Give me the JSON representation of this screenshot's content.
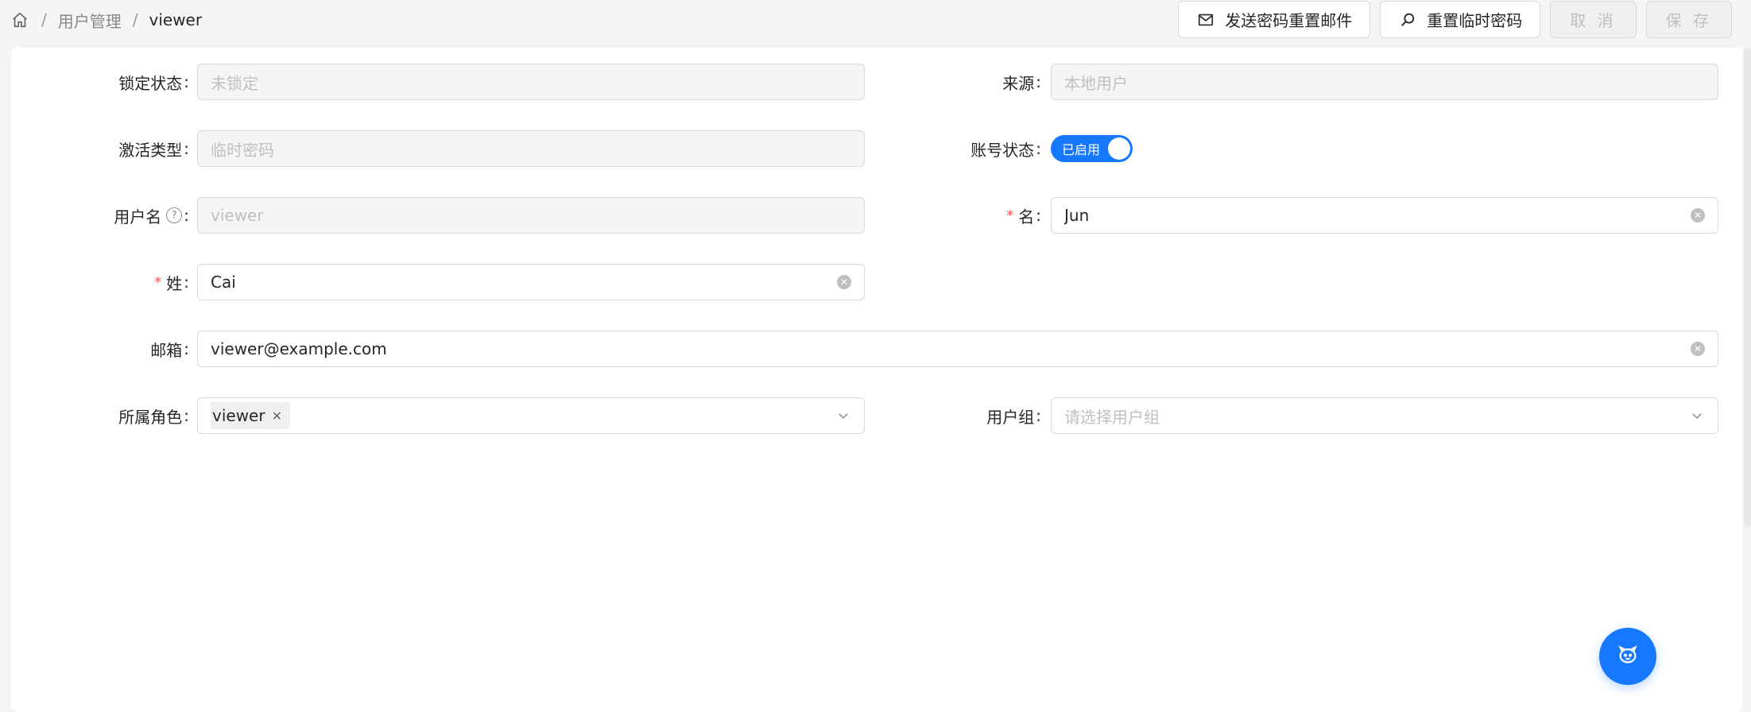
{
  "breadcrumb": {
    "home_icon": "home-icon",
    "separator": "/",
    "items": [
      "用户管理",
      "viewer"
    ]
  },
  "actions": {
    "send_reset_email": "发送密码重置邮件",
    "reset_temp_password": "重置临时密码",
    "cancel": "取 消",
    "save": "保 存"
  },
  "form": {
    "lock_status": {
      "label": "锁定状态",
      "value": "未锁定"
    },
    "source": {
      "label": "来源",
      "value": "本地用户"
    },
    "activation_type": {
      "label": "激活类型",
      "value": "临时密码"
    },
    "account_status": {
      "label": "账号状态",
      "switch_text": "已启用",
      "enabled": true
    },
    "username": {
      "label": "用户名",
      "value": "viewer",
      "help_icon": "question-circle-icon"
    },
    "first_name": {
      "label": "名",
      "value": "Jun",
      "required": true
    },
    "last_name": {
      "label": "姓",
      "value": "Cai",
      "required": true
    },
    "email": {
      "label": "邮箱",
      "value": "viewer@example.com"
    },
    "roles": {
      "label": "所属角色",
      "tags": [
        "viewer"
      ]
    },
    "user_group": {
      "label": "用户组",
      "placeholder": "请选择用户组"
    }
  },
  "colors": {
    "primary": "#1677ff",
    "required": "#ff4d4f"
  }
}
